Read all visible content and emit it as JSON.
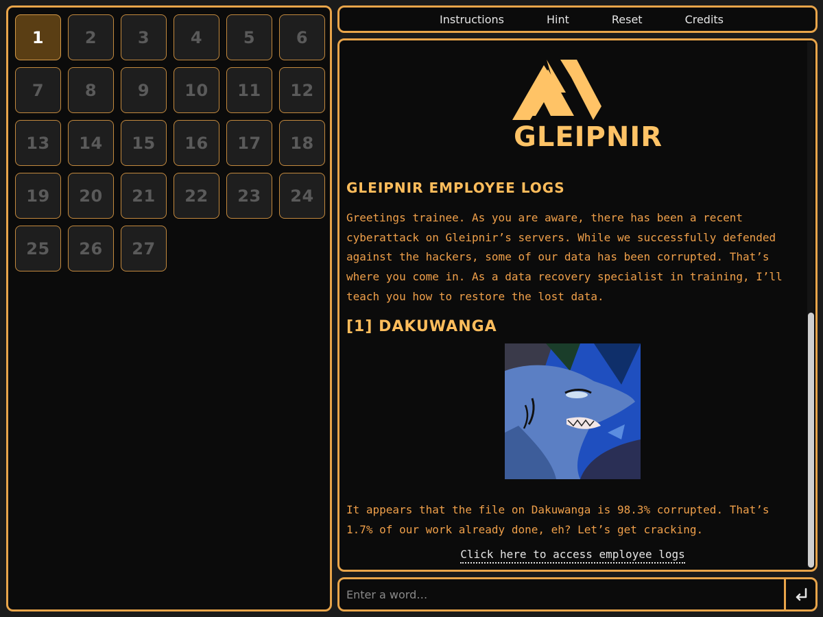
{
  "levels": [
    "1",
    "2",
    "3",
    "4",
    "5",
    "6",
    "7",
    "8",
    "9",
    "10",
    "11",
    "12",
    "13",
    "14",
    "15",
    "16",
    "17",
    "18",
    "19",
    "20",
    "21",
    "22",
    "23",
    "24",
    "25",
    "26",
    "27"
  ],
  "active_level": "1",
  "nav": {
    "instructions": "Instructions",
    "hint": "Hint",
    "reset": "Reset",
    "credits": "Credits"
  },
  "content": {
    "logo_text": "GLEIPNIR",
    "section_title": "GLEIPNIR EMPLOYEE LOGS",
    "intro": "Greetings trainee. As you are aware, there has been a recent cyberattack on Gleipnir’s servers. While we successfully defended against the hackers, some of our data has been corrupted. That’s where you come in. As a data recovery specialist in training, I’ll teach you how to restore the lost data.",
    "entry_title": "[1] DAKUWANGA",
    "status": "It appears that the file on Dakuwanga is 98.3% corrupted. That’s 1.7% of our work already done, eh? Let’s get cracking.",
    "link": "Click here to access employee logs"
  },
  "input": {
    "placeholder": "Enter a word…",
    "submit_icon": "enter-icon"
  },
  "colors": {
    "accent": "#e9a54a",
    "gold_text": "#ffbd5c",
    "body_text": "#f0a04a",
    "active_level_bg": "#5a3e14"
  }
}
